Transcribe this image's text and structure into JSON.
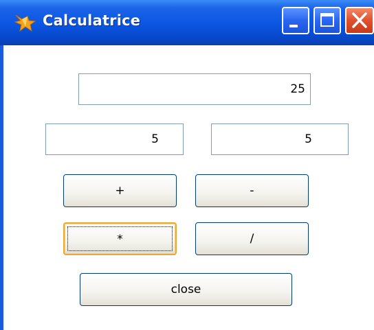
{
  "window": {
    "title": "Calculatrice",
    "app_icon": "fox-icon",
    "controls": {
      "minimize_icon": "minimize-icon",
      "maximize_icon": "maximize-icon",
      "close_icon": "close-icon"
    }
  },
  "form": {
    "result_value": "25",
    "operand1_value": "5",
    "operand2_value": "5"
  },
  "buttons": {
    "add": "+",
    "subtract": "-",
    "multiply": "*",
    "divide": "/",
    "close": "close"
  },
  "state": {
    "focused_button": "multiply"
  },
  "colors": {
    "titlebar": "#0a55e2",
    "focus_border": "#e9a83a",
    "field_border": "#7f9db9",
    "close_button": "#e0502e"
  }
}
